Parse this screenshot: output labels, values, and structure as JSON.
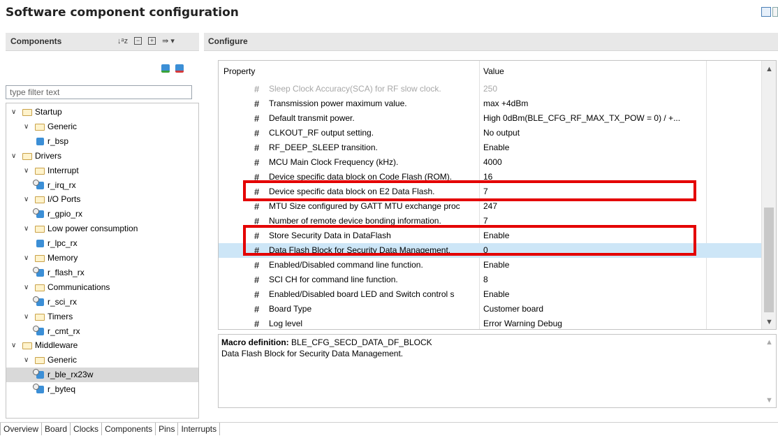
{
  "title": "Software component configuration",
  "components_panel": {
    "header": "Components",
    "filter_placeholder": "type filter text",
    "tree": [
      {
        "label": "Startup",
        "type": "folder",
        "level": 0
      },
      {
        "label": "Generic",
        "type": "folder",
        "level": 1
      },
      {
        "label": "r_bsp",
        "type": "component",
        "level": 2
      },
      {
        "label": "Drivers",
        "type": "folder",
        "level": 0
      },
      {
        "label": "Interrupt",
        "type": "folder",
        "level": 1
      },
      {
        "label": "r_irq_rx",
        "type": "component",
        "level": 2
      },
      {
        "label": "I/O Ports",
        "type": "folder",
        "level": 1
      },
      {
        "label": "r_gpio_rx",
        "type": "component",
        "level": 2
      },
      {
        "label": "Low power consumption",
        "type": "folder",
        "level": 1
      },
      {
        "label": "r_lpc_rx",
        "type": "component",
        "level": 2
      },
      {
        "label": "Memory",
        "type": "folder",
        "level": 1
      },
      {
        "label": "r_flash_rx",
        "type": "component",
        "level": 2
      },
      {
        "label": "Communications",
        "type": "folder",
        "level": 1
      },
      {
        "label": "r_sci_rx",
        "type": "component",
        "level": 2
      },
      {
        "label": "Timers",
        "type": "folder",
        "level": 1
      },
      {
        "label": "r_cmt_rx",
        "type": "component",
        "level": 2
      },
      {
        "label": "Middleware",
        "type": "folder",
        "level": 0
      },
      {
        "label": "Generic",
        "type": "folder",
        "level": 1
      },
      {
        "label": "r_ble_rx23w",
        "type": "component",
        "level": 2,
        "selected": true
      },
      {
        "label": "r_byteq",
        "type": "component",
        "level": 2
      }
    ]
  },
  "configure_panel": {
    "header": "Configure",
    "columns": {
      "property": "Property",
      "value": "Value"
    },
    "rows": [
      {
        "property": "Sleep Clock Accuracy(SCA) for RF slow clock.",
        "value": "250",
        "disabled": true
      },
      {
        "property": "Transmission power maximum value.",
        "value": "max +4dBm"
      },
      {
        "property": "Default transmit power.",
        "value": "High  0dBm(BLE_CFG_RF_MAX_TX_POW = 0)  /  +..."
      },
      {
        "property": "CLKOUT_RF output setting.",
        "value": "No output"
      },
      {
        "property": "RF_DEEP_SLEEP transition.",
        "value": "Enable"
      },
      {
        "property": "MCU Main Clock Frequency (kHz).",
        "value": "4000"
      },
      {
        "property": "Device specific data block on Code Flash (ROM).",
        "value": "16"
      },
      {
        "property": "Device specific data block on E2 Data Flash.",
        "value": "7"
      },
      {
        "property": "MTU Size configured by GATT MTU exchange proc",
        "value": "247"
      },
      {
        "property": "Number of remote device bonding information.",
        "value": "7"
      },
      {
        "property": "Store Security Data in DataFlash",
        "value": "Enable"
      },
      {
        "property": "Data Flash Block for Security Data Management.",
        "value": "0",
        "selected": true
      },
      {
        "property": "Enabled/Disabled command line function.",
        "value": "Enable"
      },
      {
        "property": "SCI CH for command line function.",
        "value": "8"
      },
      {
        "property": "Enabled/Disabled board LED and Switch control s",
        "value": "Enable"
      },
      {
        "property": "Board Type",
        "value": "Customer board"
      },
      {
        "property": "Log level",
        "value": "Error Warning Debug"
      }
    ],
    "description": {
      "label": "Macro definition:",
      "macro": "BLE_CFG_SECD_DATA_DF_BLOCK",
      "text": "Data Flash Block for Security Data Management."
    }
  },
  "tabs": [
    "Overview",
    "Board",
    "Clocks",
    "Components",
    "Pins",
    "Interrupts"
  ],
  "colors": {
    "highlight_box": "#e40000",
    "selected_row": "#cde6f7",
    "selected_tree": "#d9d9d9"
  }
}
